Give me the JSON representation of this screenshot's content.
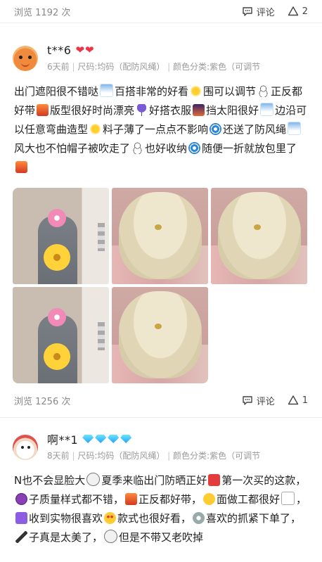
{
  "top_stats": {
    "views": "浏览 1192 次",
    "comment_label": "评论",
    "like_count": "2"
  },
  "review1": {
    "username": "t**6",
    "badge": "hearts",
    "meta": [
      "6天前",
      "尺码:均码（配防风绳）",
      "颜色分类:紫色（可调节"
    ],
    "text_segments": [
      {
        "t": "出门遮阳很不错哒",
        "e": "e-sky"
      },
      {
        "t": "百搭非常的好看",
        "e": "e-sun"
      },
      {
        "t": "围可以调节",
        "e": "e-snow"
      },
      {
        "t": "正反都好带",
        "e": "e-city"
      },
      {
        "t": "版型很好时尚漂亮",
        "e": "e-umb"
      },
      {
        "t": "好搭衣服",
        "e": "e-night"
      },
      {
        "t": "挡太阳很好",
        "e": "e-sky"
      },
      {
        "t": "边沿可以任意弯曲造型",
        "e": "e-sun"
      },
      {
        "t": "料子薄了一点点不影响",
        "e": "e-swirl"
      },
      {
        "t": "还送了防风绳",
        "e": "e-sky"
      },
      {
        "t": "风大也不怕帽子被吹走了",
        "e": "e-snow"
      },
      {
        "t": "也好收纳",
        "e": "e-swirl"
      },
      {
        "t": "随便一折就放包里了",
        "e": "e-city"
      }
    ],
    "photos": [
      "person",
      "hat",
      "hat",
      "person",
      "hat"
    ],
    "stats": {
      "views": "浏览 1256 次",
      "comment_label": "评论",
      "like_count": "1"
    }
  },
  "review2": {
    "username": "啊**1",
    "badge": "diamonds",
    "meta": [
      "8天前",
      "尺码:均码（配防风绳）",
      "颜色分类:紫色（可调节"
    ],
    "text_segments": [
      {
        "t": "N也不会显脸大",
        "e": "e-clock"
      },
      {
        "t": "夏季来临出门防晒正好",
        "e": "e-red"
      },
      {
        "t": "第一次买的这款，",
        "e": "e-grape"
      },
      {
        "t": "子质量样式都不错，",
        "e": "e-city"
      },
      {
        "t": "正反都好带，",
        "e": "e-smile"
      },
      {
        "t": "面做工都很好",
        "e": "e-arrow"
      },
      {
        "t": "，",
        "e": "e-up"
      },
      {
        "t": "收到实物很喜欢",
        "e": "e-heart-eyes"
      },
      {
        "t": "款式也很好看，",
        "e": "e-gear"
      },
      {
        "t": "喜欢的抓紧下单了，",
        "e": "e-pen"
      },
      {
        "t": "子真是太美了，",
        "e": "e-clock"
      },
      {
        "t": "但是不带又老吹掉",
        "e": ""
      }
    ]
  }
}
